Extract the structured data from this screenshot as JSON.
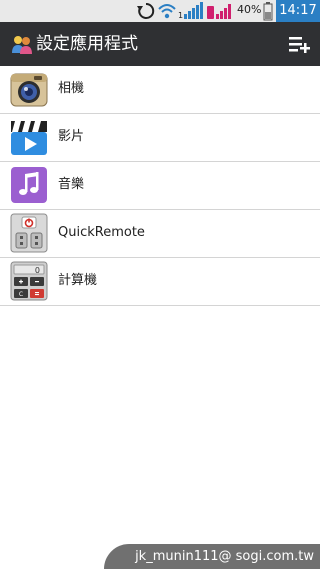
{
  "status_bar": {
    "battery_percent": "40%",
    "time": "14:17",
    "icons": [
      "sync-icon",
      "wifi-icon",
      "signal-icon",
      "sim-icon",
      "battery-icon"
    ]
  },
  "app_bar": {
    "title": "設定應用程式",
    "icons": [
      "users-icon",
      "add-to-list-icon"
    ]
  },
  "apps": [
    {
      "label": "相機",
      "icon": "camera-icon"
    },
    {
      "label": "影片",
      "icon": "video-icon"
    },
    {
      "label": "音樂",
      "icon": "music-icon"
    },
    {
      "label": "QuickRemote",
      "icon": "remote-icon"
    },
    {
      "label": "計算機",
      "icon": "calculator-icon"
    }
  ],
  "watermark": {
    "text": "jk_munin111@ sogi.com.tw"
  },
  "colors": {
    "status_bar_bg": "#e9e9e9",
    "app_bar_bg": "#2f3033",
    "time_bg": "#2b7fc4",
    "divider": "#d4d4d4"
  }
}
